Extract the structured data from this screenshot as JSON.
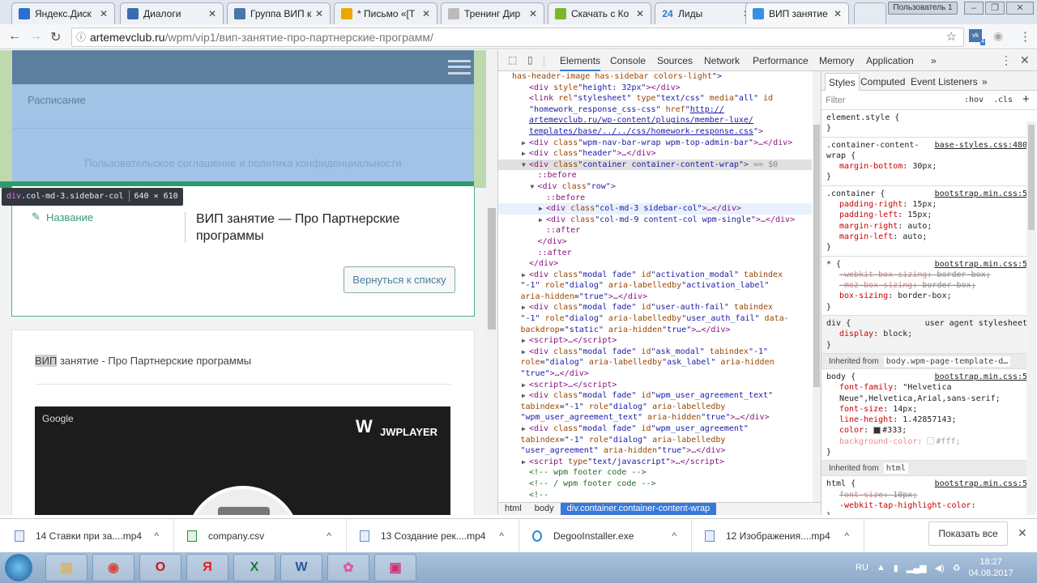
{
  "browser": {
    "tabs": [
      {
        "label": "Яндекс.Диск",
        "icon": "yandex-disk-icon",
        "color": "#2a6fd1"
      },
      {
        "label": "Диалоги",
        "icon": "dialogs-icon",
        "color": "#3a6db0"
      },
      {
        "label": "Группа ВИП к",
        "icon": "vk-icon",
        "color": "#4a76a8"
      },
      {
        "label": "* Письмо «[Т",
        "icon": "mail-icon",
        "color": "#e8a800"
      },
      {
        "label": "Тренинг Дир",
        "icon": "page-icon",
        "color": "#bbbbbb"
      },
      {
        "label": "Скачать с Ко",
        "icon": "download-arrow-icon",
        "color": "#7ab828"
      },
      {
        "label": "Лиды",
        "icon": "bitrix24-icon",
        "color": "#2a7ad1",
        "icon_text": "24"
      },
      {
        "label": "ВИП занятие",
        "icon": "site-icon",
        "color": "#3a90e0",
        "active": true
      }
    ],
    "user_label": "Пользователь 1",
    "url_host": "artemevclub.ru",
    "url_path": "/wpm/vip1/вип-занятие-про-партнерские-программ/",
    "ext_badge": "4"
  },
  "page": {
    "menu_item": "Расписание",
    "agreement_link": "Пользовательское соглашение и политика конфиденциальности",
    "inspect_tooltip": {
      "tag": "div",
      "classes": ".col-md-3.sidebar-col",
      "size": "640 × 610"
    },
    "field_label": "Название",
    "lesson_title": "ВИП занятие — Про Партнерские программы",
    "back_button": "Вернуться к списку",
    "card_title_highlight": "ВИП",
    "card_title_rest": " занятие - Про Партнерские программы",
    "video_brand": "Google",
    "video_player": "JWPLAYER"
  },
  "devtools": {
    "tabs": [
      "Elements",
      "Console",
      "Sources",
      "Network",
      "Performance",
      "Memory",
      "Application",
      "»"
    ],
    "active_tab": "Elements",
    "elements": {
      "lines": [
        {
          "d": 0,
          "t": "has-header-image has-sidebar colors-light\">"
        },
        {
          "d": 2,
          "t": "<div style=\"height: 32px\"></div>"
        },
        {
          "d": 2,
          "t": "<link rel=\"stylesheet\" type=\"text/css\" media=\"all\" id="
        },
        {
          "d": 2,
          "t": "\"homework_response_css-css\" href=\"http://"
        },
        {
          "d": 2,
          "t": "artemevclub.ru/wp-content/plugins/member-luxe/",
          "link": true
        },
        {
          "d": 2,
          "t": "templates/base/../../css/homework-response.css\">",
          "link": true
        },
        {
          "d": 2,
          "a": "▶",
          "t": "<div class=\"wpm-nav-bar-wrap wpm-top-admin-bar\">…</div>"
        },
        {
          "d": 2,
          "a": "▶",
          "t": "<div class=\"header\">…</div>"
        },
        {
          "d": 2,
          "a": "▼",
          "t": "<div class=\"container container-content-wrap\"> == $0",
          "sel": true
        },
        {
          "d": 3,
          "t": "::before"
        },
        {
          "d": 3,
          "a": "▼",
          "t": "<div class=\"row\">"
        },
        {
          "d": 4,
          "t": "::before"
        },
        {
          "d": 4,
          "a": "▶",
          "t": "<div class=\"col-md-3 sidebar-col\">…</div>",
          "hov": true
        },
        {
          "d": 4,
          "a": "▶",
          "t": "<div class=\"col-md-9 content-col wpm-single\">…</div>"
        },
        {
          "d": 4,
          "t": "::after"
        },
        {
          "d": 3,
          "t": "</div>"
        },
        {
          "d": 3,
          "t": "::after"
        },
        {
          "d": 2,
          "t": "</div>"
        },
        {
          "d": 2,
          "a": "▶",
          "t": "<div class=\"modal fade\" id=\"activation_modal\" tabindex="
        },
        {
          "d": 1,
          "t": "\"-1\" role=\"dialog\" aria-labelledby=\"activation_label\""
        },
        {
          "d": 1,
          "t": "aria-hidden=\"true\">…</div>"
        },
        {
          "d": 2,
          "a": "▶",
          "t": "<div class=\"modal fade\" id=\"user-auth-fail\" tabindex="
        },
        {
          "d": 1,
          "t": "\"-1\" role=\"dialog\" aria-labelledby=\"user_auth_fail\" data-"
        },
        {
          "d": 1,
          "t": "backdrop=\"static\" aria-hidden=\"true\">…</div>"
        },
        {
          "d": 2,
          "a": "▶",
          "t": "<script>…</script>"
        },
        {
          "d": 2,
          "a": "▶",
          "t": "<div class=\"modal fade\" id=\"ask_modal\" tabindex=\"-1\""
        },
        {
          "d": 1,
          "t": "role=\"dialog\" aria-labelledby=\"ask_label\" aria-hidden="
        },
        {
          "d": 1,
          "t": "\"true\">…</div>"
        },
        {
          "d": 2,
          "a": "▶",
          "t": "<script>…</script>"
        },
        {
          "d": 2,
          "a": "▶",
          "t": "<div class=\"modal fade\" id=\"wpm_user_agreement_text\""
        },
        {
          "d": 1,
          "t": "tabindex=\"-1\" role=\"dialog\" aria-labelledby="
        },
        {
          "d": 1,
          "t": "\"wpm_user_agreement_text\" aria-hidden=\"true\">…</div>"
        },
        {
          "d": 2,
          "a": "▶",
          "t": "<div class=\"modal fade\" id=\"wpm_user_agreement\""
        },
        {
          "d": 1,
          "t": "tabindex=\"-1\" role=\"dialog\" aria-labelledby="
        },
        {
          "d": 1,
          "t": "\"user_agreement\" aria-hidden=\"true\">…</div>"
        },
        {
          "d": 2,
          "a": "▶",
          "t": "<script type=\"text/javascript\">…</script>"
        },
        {
          "d": 2,
          "t": "<!-- wpm footer code -->",
          "cm": true
        },
        {
          "d": 2,
          "t": "<!-- / wpm footer code -->",
          "cm": true
        },
        {
          "d": 2,
          "t": "<!--",
          "cm": true
        }
      ]
    },
    "breadcrumbs": [
      "html",
      "body",
      "div.container.container-content-wrap"
    ],
    "styles": {
      "tabs": [
        "Styles",
        "Computed",
        "Event Listeners",
        "»"
      ],
      "filter_placeholder": "Filter",
      "hov": ":hov",
      "cls": ".cls",
      "add": "+",
      "rules": [
        {
          "sel": "element.style {",
          "src": "",
          "props": []
        },
        {
          "sel": ".container-content-",
          "sel2": "wrap {",
          "src": "base-styles.css:480",
          "props": [
            {
              "n": "margin-bottom",
              "v": "30px;"
            }
          ]
        },
        {
          "sel": ".container {",
          "src": "bootstrap.min.css:5",
          "props": [
            {
              "n": "padding-right",
              "v": "15px;"
            },
            {
              "n": "padding-left",
              "v": "15px;"
            },
            {
              "n": "margin-right",
              "v": "auto;"
            },
            {
              "n": "margin-left",
              "v": "auto;"
            }
          ]
        },
        {
          "sel": "* {",
          "src": "bootstrap.min.css:5",
          "props": [
            {
              "n": "-webkit-box-sizing",
              "v": "border-box;",
              "st": true
            },
            {
              "n": "-moz-box-sizing",
              "v": "border-box;",
              "st": true
            },
            {
              "n": "box-sizing",
              "v": "border-box;"
            }
          ]
        },
        {
          "sel": "div {",
          "src": "user agent stylesheet",
          "ua": true,
          "props": [
            {
              "n": "display",
              "v": "block;"
            }
          ]
        }
      ],
      "inherited_label": "Inherited from",
      "inherited_body": "body.wpm-page-template-d…",
      "body_rule": {
        "sel": "body {",
        "src": "bootstrap.min.css:5",
        "props": [
          {
            "n": "font-family",
            "v": "\"Helvetica"
          },
          {
            "n": "",
            "v": "   Neue\",Helvetica,Arial,sans-serif;"
          },
          {
            "n": "font-size",
            "v": "14px;"
          },
          {
            "n": "line-height",
            "v": "1.42857143;"
          },
          {
            "n": "color",
            "v": "#333;",
            "swatch": "#333333"
          },
          {
            "n": "background-color",
            "v": "#fff;",
            "swatch": "#ffffff",
            "dim": true
          }
        ]
      },
      "inherited_html": "html",
      "html_rule": {
        "sel": "html {",
        "src": "bootstrap.min.css:5",
        "props": [
          {
            "n": "font-size",
            "v": "10px;",
            "st": true
          },
          {
            "n": "-webkit-tap-highlight-color",
            "v": ""
          }
        ]
      }
    }
  },
  "downloads": {
    "items": [
      "14 Ставки при за....mp4",
      "company.csv",
      "13 Создание рек....mp4",
      "DegooInstaller.exe",
      "12 Изображения....mp4"
    ],
    "show_all": "Показать все"
  },
  "taskbar": {
    "apps": [
      "explorer",
      "chrome",
      "opera",
      "yandex-browser",
      "excel",
      "word",
      "picasa",
      "screen-recorder"
    ],
    "lang": "RU",
    "time": "18:27",
    "date": "04.08.2017"
  }
}
